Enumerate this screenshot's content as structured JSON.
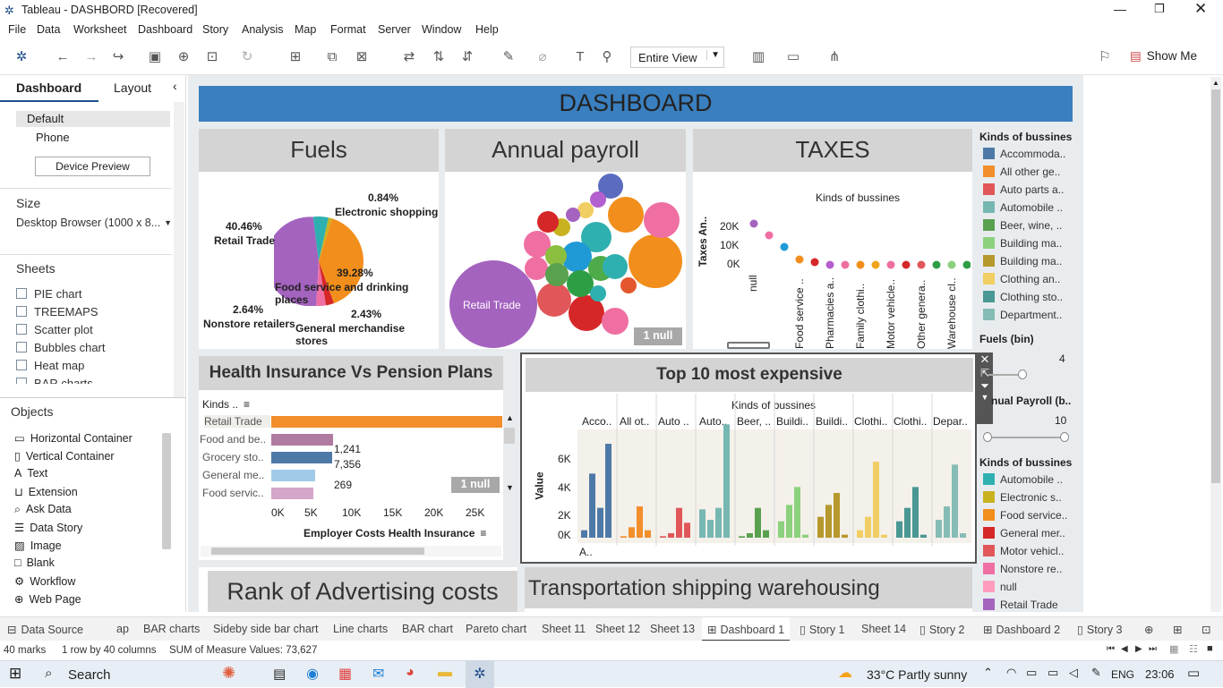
{
  "window": {
    "title": "Tableau - DASHBORD [Recovered]"
  },
  "menu": [
    "File",
    "Data",
    "Worksheet",
    "Dashboard",
    "Story",
    "Analysis",
    "Map",
    "Format",
    "Server",
    "Window",
    "Help"
  ],
  "toolbar": {
    "fit": "Entire View",
    "show_me": "Show Me"
  },
  "left": {
    "tab_dashboard": "Dashboard",
    "tab_layout": "Layout",
    "device_default": "Default",
    "device_phone": "Phone",
    "device_preview": "Device Preview",
    "size_label": "Size",
    "size_value": "Desktop Browser (1000 x 8...",
    "sheets_label": "Sheets",
    "sheets": [
      "PIE chart",
      "TREEMAPS",
      "Scatter plot",
      "Bubbles chart",
      "Heat map",
      "BAR charts"
    ],
    "objects_label": "Objects",
    "objects": [
      "Horizontal Container",
      "Vertical Container",
      "Text",
      "Extension",
      "Ask Data",
      "Data Story",
      "Image",
      "Blank",
      "Workflow",
      "Web Page"
    ]
  },
  "dashboard": {
    "header": "DASHBOARD",
    "fuels": {
      "title": "Fuels",
      "labels": [
        {
          "pct": "0.84%",
          "name": "Electronic shopping"
        },
        {
          "pct": "40.46%",
          "name": "Retail Trade"
        },
        {
          "pct": "39.28%",
          "name": "Food service and drinking places"
        },
        {
          "pct": "2.64%",
          "name": "Nonstore retailers"
        },
        {
          "pct": "2.43%",
          "name": "General merchandise stores"
        }
      ]
    },
    "payroll": {
      "title": "Annual payroll",
      "big_label": "Retail Trade",
      "null_badge": "1 null"
    },
    "taxes": {
      "title": "TAXES",
      "chart_title": "Kinds of bussines",
      "ylabel": "Taxes An..",
      "yticks": [
        "20K",
        "10K",
        "0K"
      ],
      "xlabels": [
        "null",
        "Food service ..",
        "Pharmacies a..",
        "Family clothi..",
        "Motor vehicle..",
        "Other genera..",
        "Warehouse cl.."
      ]
    },
    "health": {
      "title": "Health Insurance Vs Pension  Plans",
      "col_header": "Kinds ..",
      "rows": [
        "Retail Trade",
        "Food and be..",
        "Grocery sto..",
        "General me..",
        "Food servic.."
      ],
      "values": [
        "1,241",
        "7,356",
        "269"
      ],
      "null_badge": "1 null",
      "xticks": [
        "0K",
        "5K",
        "10K",
        "15K",
        "20K",
        "25K"
      ],
      "xlabel": "Employer Costs Health Insurance"
    },
    "top10": {
      "title": "Top 10 most expensive",
      "chart_title": "Kinds of bussines",
      "columns": [
        "Acco..",
        "All ot..",
        "Auto ..",
        "Auto..",
        "Beer, ..",
        "Buildi..",
        "Buildi..",
        "Clothi..",
        "Clothi..",
        "Depar.."
      ],
      "ylabel": "Value",
      "yticks": [
        "6K",
        "4K",
        "2K",
        "0K"
      ],
      "foot": "A.."
    },
    "rank": {
      "title": "Rank of Advertising costs"
    },
    "transport": {
      "title": "Transportation shipping warehousing"
    }
  },
  "legend1": {
    "title": "Kinds of bussines",
    "items": [
      {
        "label": "Accommoda..",
        "color": "#4e79a7"
      },
      {
        "label": "All other ge..",
        "color": "#f28e2b"
      },
      {
        "label": "Auto parts a..",
        "color": "#e15759"
      },
      {
        "label": "Automobile ..",
        "color": "#76b7b2"
      },
      {
        "label": "Beer, wine, ..",
        "color": "#59a14f"
      },
      {
        "label": "Building ma..",
        "color": "#8cd17d"
      },
      {
        "label": "Building ma..",
        "color": "#b6992d"
      },
      {
        "label": "Clothing an..",
        "color": "#f1ce63"
      },
      {
        "label": "Clothing sto..",
        "color": "#499894"
      },
      {
        "label": "Department..",
        "color": "#86bcb6"
      }
    ]
  },
  "fuels_bin": {
    "label": "Fuels (bin)",
    "value": "4"
  },
  "payroll_bin": {
    "label": "nual Payroll (b..",
    "value": "10"
  },
  "legend2": {
    "title": "Kinds of bussines",
    "items": [
      {
        "label": "Automobile ..",
        "color": "#2fb0b0"
      },
      {
        "label": "Electronic s..",
        "color": "#c9b21f"
      },
      {
        "label": "Food service..",
        "color": "#f28e1b"
      },
      {
        "label": "General mer..",
        "color": "#d62728"
      },
      {
        "label": "Motor vehicl..",
        "color": "#e15759"
      },
      {
        "label": "Nonstore re..",
        "color": "#ef6fa3"
      },
      {
        "label": "null",
        "color": "#ff9dbf"
      },
      {
        "label": "Retail Trade",
        "color": "#a463bf"
      }
    ]
  },
  "tabs": [
    "Data Source",
    "ap",
    "BAR charts",
    "Sideby side bar chart",
    "Line charts",
    "BAR chart",
    "Pareto chart",
    "Sheet 11",
    "Sheet 12",
    "Sheet 13",
    "Dashboard 1",
    "Story 1",
    "Sheet 14",
    "Story 2",
    "Dashboard 2",
    "Story 3"
  ],
  "info": {
    "marks": "40 marks",
    "rows": "1 row by 40 columns",
    "sum": "SUM of Measure Values: 73,627"
  },
  "taskbar": {
    "search": "Search",
    "weather": "33°C  Partly sunny",
    "lang": "ENG",
    "time": "23:06"
  },
  "chart_data": [
    {
      "type": "pie",
      "title": "Fuels",
      "values": [
        {
          "label": "Retail Trade",
          "value": 40.46
        },
        {
          "label": "Food service and drinking places",
          "value": 39.28
        },
        {
          "label": "Nonstore retailers",
          "value": 2.64
        },
        {
          "label": "General merchandise stores",
          "value": 2.43
        },
        {
          "label": "Electronic shopping",
          "value": 0.84
        }
      ]
    },
    {
      "type": "scatter",
      "title": "Kinds of bussines",
      "ylabel": "Taxes An..",
      "ylim": [
        0,
        25000
      ],
      "points": [
        {
          "x": "null",
          "y": 21000
        },
        {
          "x": "Food service ..",
          "y": 0
        }
      ]
    },
    {
      "type": "bar",
      "title": "Health Insurance Vs Pension  Plans",
      "xlabel": "Employer Costs Health Insurance",
      "categories": [
        "Retail Trade",
        "Food and be..",
        "Grocery sto..",
        "General me..",
        "Food servic.."
      ],
      "values": [
        28000,
        7356,
        7400,
        5300,
        5000
      ],
      "xlim": [
        0,
        27000
      ]
    },
    {
      "type": "bar",
      "title": "Top 10 most expensive",
      "ylabel": "Value",
      "ylim": [
        0,
        7500
      ],
      "categories": [
        "Acco..",
        "All ot..",
        "Auto ..",
        "Auto..",
        "Beer, ..",
        "Buildi..",
        "Buildi..",
        "Clothi..",
        "Clothi..",
        "Depar.."
      ],
      "series": [
        {
          "values": [
            500,
            4300,
            2000,
            6300
          ]
        },
        {
          "values": [
            100,
            700,
            2100,
            500
          ]
        },
        {
          "values": [
            100,
            300,
            2000,
            1000
          ]
        },
        {
          "values": [
            1900,
            1200,
            2000,
            7600
          ]
        },
        {
          "values": [
            100,
            300,
            2000,
            500
          ]
        },
        {
          "values": [
            1100,
            2200,
            3400,
            200
          ]
        },
        {
          "values": [
            1400,
            2200,
            3000,
            200
          ]
        },
        {
          "values": [
            500,
            1400,
            5100,
            200
          ]
        },
        {
          "values": [
            1100,
            2000,
            3400,
            200
          ]
        },
        {
          "values": [
            1200,
            2100,
            4900,
            300
          ]
        }
      ]
    }
  ]
}
